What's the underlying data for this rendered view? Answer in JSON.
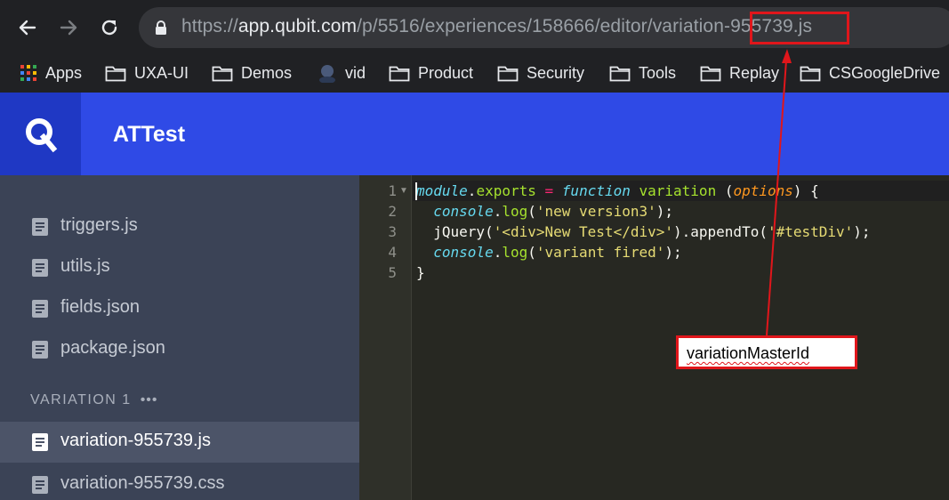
{
  "browser": {
    "url_prefix": "https://",
    "url_host": "app.qubit.com",
    "url_path": "/p/5516/experiences/158666/editor/variation-955739.js",
    "bookmarks": [
      {
        "label": "Apps",
        "icon": "apps-grid-icon"
      },
      {
        "label": "UXA-UI",
        "icon": "folder-icon"
      },
      {
        "label": "Demos",
        "icon": "folder-icon"
      },
      {
        "label": "vid",
        "icon": "avatar-icon"
      },
      {
        "label": "Product",
        "icon": "folder-icon"
      },
      {
        "label": "Security",
        "icon": "folder-icon"
      },
      {
        "label": "Tools",
        "icon": "folder-icon"
      },
      {
        "label": "Replay",
        "icon": "folder-icon"
      },
      {
        "label": "CSGoogleDrive",
        "icon": "folder-icon"
      }
    ]
  },
  "app": {
    "logo": "Q",
    "title": "ATTest",
    "brand_color": "#2f4ae6"
  },
  "sidebar": {
    "files": [
      {
        "name": "triggers.js"
      },
      {
        "name": "utils.js"
      },
      {
        "name": "fields.json"
      },
      {
        "name": "package.json"
      }
    ],
    "section_title": "VARIATION 1",
    "section_menu": "•••",
    "variation_files": [
      {
        "name": "variation-955739.js",
        "active": true
      },
      {
        "name": "variation-955739.css",
        "active": false
      }
    ]
  },
  "editor": {
    "line_numbers": [
      "1",
      "2",
      "3",
      "4",
      "5"
    ]
  },
  "annotation": {
    "label": "variationMasterId",
    "color": "#e0161b"
  }
}
